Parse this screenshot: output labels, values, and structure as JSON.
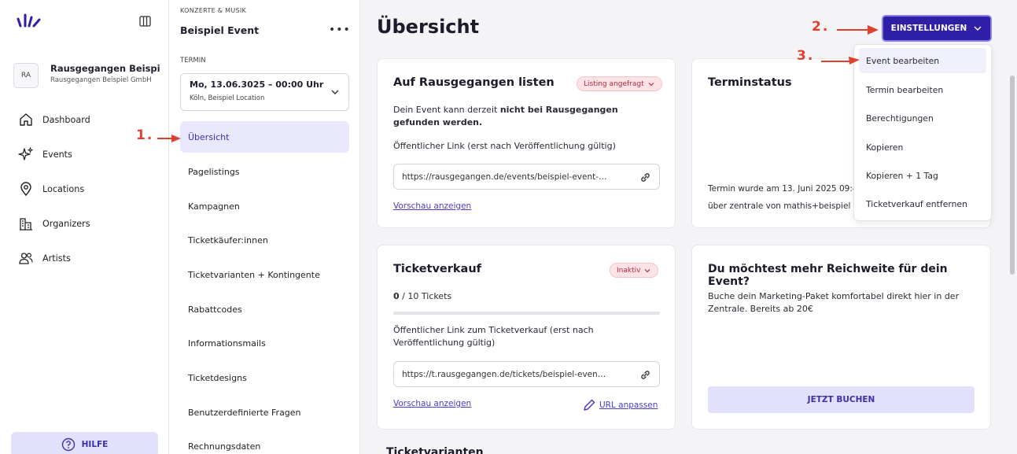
{
  "sidebar": {
    "logo_icon": "rausgegangen-logo-icon",
    "account": {
      "initials": "RA",
      "name": "Rausgegangen Beispiel…",
      "org": "Rausgegangen Beispiel GmbH"
    },
    "items": [
      {
        "label": "Dashboard",
        "icon": "home-icon"
      },
      {
        "label": "Events",
        "icon": "sparkles-icon"
      },
      {
        "label": "Locations",
        "icon": "map-pin-icon"
      },
      {
        "label": "Organizers",
        "icon": "building-icon"
      },
      {
        "label": "Artists",
        "icon": "users-icon"
      }
    ],
    "help_label": "HILFE"
  },
  "event_nav": {
    "category": "KONZERTE & MUSIK",
    "event_name": "Beispiel Event",
    "termin_label": "TERMIN",
    "termin_date": "Mo, 13.06.3025 – 00:00 Uhr",
    "termin_location": "Köln, Beispiel Location",
    "items": [
      "Übersicht",
      "Pagelistings",
      "Kampagnen",
      "Ticketkäufer:innen",
      "Ticketvarianten + Kontingente",
      "Rabattcodes",
      "Informationsmails",
      "Ticketdesigns",
      "Benutzerdefinierte Fragen",
      "Rechnungsdaten"
    ],
    "active_index": 0
  },
  "main": {
    "title": "Übersicht",
    "listing_card": {
      "title": "Auf Rausgegangen listen",
      "badge": "Listing angefragt",
      "text_pre": "Dein Event kann derzeit ",
      "text_bold": "nicht bei Rausgegangen gefunden werden.",
      "link_label": "Öffentlicher Link (erst nach Veröffentlichung gültig)",
      "link_value": "https://rausgegangen.de/events/beispiel-event-…",
      "preview": "Vorschau anzeigen"
    },
    "status_card": {
      "title": "Terminstatus",
      "line1": "Termin wurde am 13. Juni 2025 09:4",
      "line2": "über zentrale von mathis+beispiel"
    },
    "ticket_card": {
      "title": "Ticketverkauf",
      "badge": "Inaktiv",
      "sold": "0",
      "sold_suffix": " / 10 Tickets",
      "progress": 0,
      "link_label": "Öffentlicher Link zum Ticketverkauf (erst nach Veröffentlichung gültig)",
      "link_value": "https://t.rausgegangen.de/tickets/beispiel-even…",
      "preview": "Vorschau anzeigen",
      "url_edit": "URL anpassen"
    },
    "reach_card": {
      "title": "Du möchtest mehr Reichweite für dein Event?",
      "text": "Buche dein Marketing-Paket komfortabel direkt hier in der Zentrale. Bereits ab 20€",
      "button": "JETZT BUCHEN"
    },
    "next_section": "Ticketvarianten"
  },
  "settings": {
    "button_label": "EINSTELLUNGEN",
    "menu": [
      "Event bearbeiten",
      "Termin bearbeiten",
      "Berechtigungen",
      "Kopieren",
      "Kopieren + 1 Tag",
      "Ticketverkauf entfernen"
    ]
  },
  "annotations": [
    "1.",
    "2.",
    "3."
  ],
  "colors": {
    "primary": "#2e1fa6",
    "accent_light": "#e2e1fb",
    "annotation": "#e0402f",
    "badge_bg": "#fde3e6"
  }
}
